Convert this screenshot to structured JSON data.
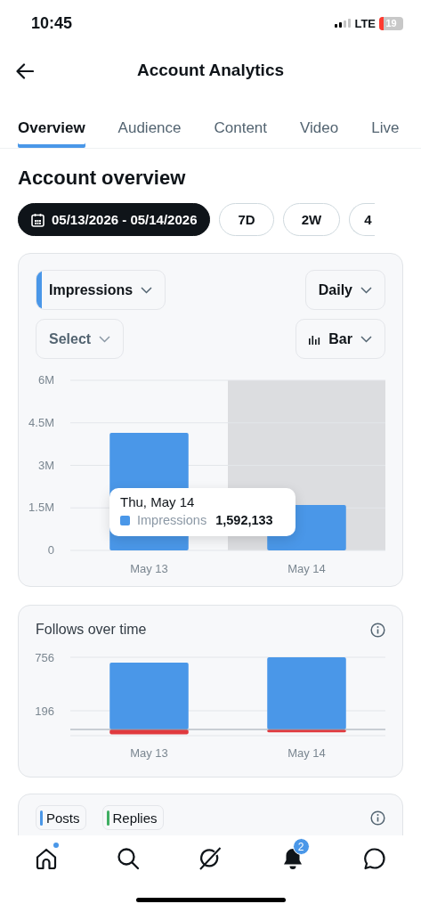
{
  "status_bar": {
    "time": "10:45",
    "network": "LTE",
    "battery": "19"
  },
  "header": {
    "title": "Account Analytics"
  },
  "tabs": [
    {
      "label": "Overview",
      "selected": true
    },
    {
      "label": "Audience",
      "selected": false
    },
    {
      "label": "Content",
      "selected": false
    },
    {
      "label": "Video",
      "selected": false
    },
    {
      "label": "Live",
      "selected": false
    }
  ],
  "section_title": "Account overview",
  "date_filters": [
    {
      "label": "05/13/2026 - 05/14/2026",
      "selected": true,
      "kind": "range"
    },
    {
      "label": "7D",
      "selected": false,
      "kind": "preset"
    },
    {
      "label": "2W",
      "selected": false,
      "kind": "preset"
    },
    {
      "label": "4",
      "selected": false,
      "kind": "preset"
    }
  ],
  "impressions_card": {
    "metric_select": {
      "label": "Impressions",
      "color": "#4a97e8"
    },
    "interval_select": {
      "label": "Daily"
    },
    "compare_select": {
      "placeholder": "Select"
    },
    "chart_type_select": {
      "label": "Bar"
    },
    "highlighted": [
      false,
      true
    ],
    "chart_data": {
      "type": "bar",
      "categories": [
        "May 13",
        "May 14"
      ],
      "series": [
        {
          "name": "Impressions",
          "color": "#4a97e8",
          "values": [
            4150000,
            1600000
          ]
        }
      ],
      "grid": true,
      "ylim": [
        0,
        6000000
      ],
      "yticks": [
        {
          "value": 0,
          "label": "0"
        },
        {
          "value": 1500000,
          "label": "1.5M"
        },
        {
          "value": 3000000,
          "label": "3M"
        },
        {
          "value": 4500000,
          "label": "4.5M"
        },
        {
          "value": 6000000,
          "label": "6M"
        }
      ]
    },
    "tooltip": {
      "date": "Thu, May 14",
      "value": "1,592,133",
      "color": "#4a97e8"
    }
  },
  "follows_card": {
    "title": "Follows over time",
    "chart_data": {
      "type": "bar",
      "stacked": true,
      "categories": [
        "May 13",
        "May 14"
      ],
      "series": [
        {
          "color": "#4a97e8",
          "values": [
            700,
            756
          ]
        },
        {
          "color": "#e0393e",
          "values": [
            -50,
            -30
          ]
        }
      ],
      "grid": true,
      "ylim": [
        -65,
        756
      ],
      "yticks": [
        196,
        756
      ]
    }
  },
  "metrics_card": {
    "metrics": [
      {
        "label": "Posts",
        "color": "#4a97e8"
      },
      {
        "label": "Replies",
        "color": "#3fae62"
      }
    ]
  },
  "nav": [
    {
      "kind": "home",
      "dot": true
    },
    {
      "kind": "search"
    },
    {
      "kind": "slash"
    },
    {
      "kind": "bell",
      "badge": "2"
    },
    {
      "kind": "chat"
    }
  ]
}
